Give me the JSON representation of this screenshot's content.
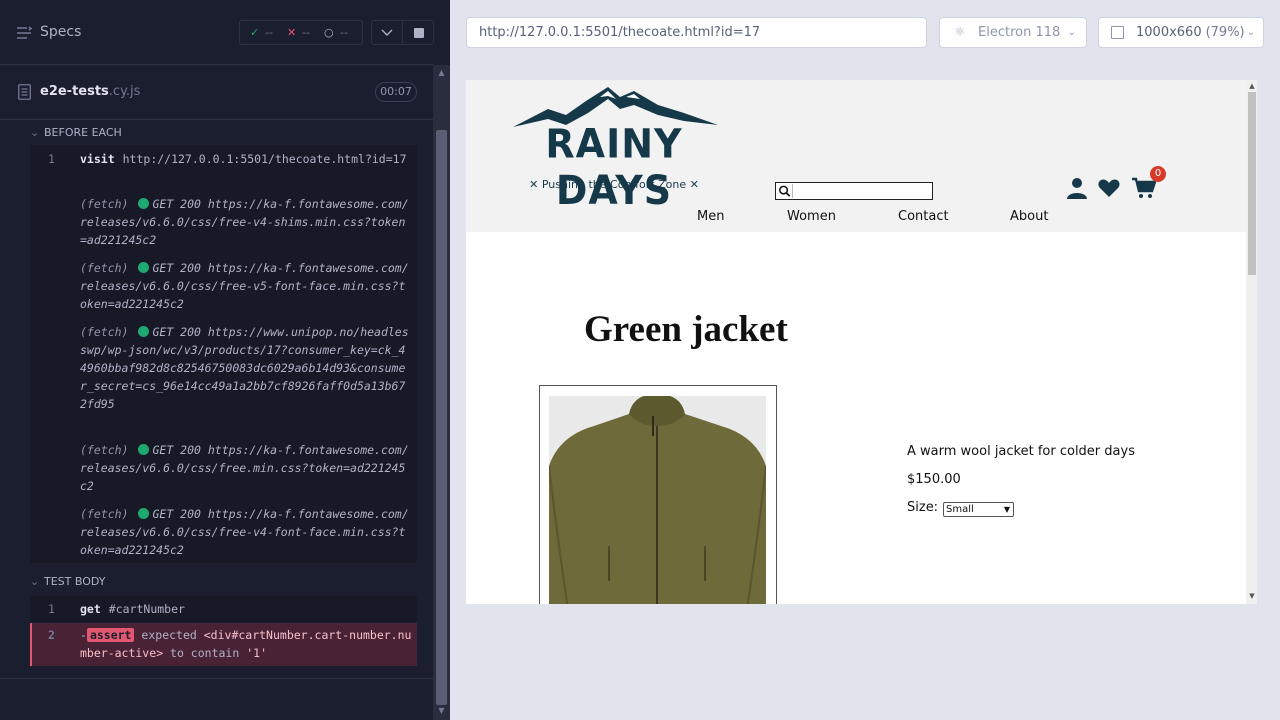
{
  "reporter": {
    "specs_label": "Specs",
    "stats": {
      "passed": "--",
      "failed": "--",
      "pending": "--"
    },
    "file": {
      "name": "e2e-tests",
      "ext": ".cy.js",
      "duration": "00:07"
    },
    "before_each": {
      "title": "BEFORE EACH",
      "commands": [
        {
          "num": "1",
          "name": "visit",
          "message": "http://127.0.0.1:5501/thecoate.html?id=17"
        },
        {
          "label": "(fetch)",
          "method": "GET 200",
          "url": "https://ka-f.fontawesome.com/releases/v6.6.0/css/free-v4-shims.min.css?token=ad221245c2"
        },
        {
          "label": "(fetch)",
          "method": "GET 200",
          "url": "https://ka-f.fontawesome.com/releases/v6.6.0/css/free-v5-font-face.min.css?token=ad221245c2"
        },
        {
          "label": "(fetch)",
          "method": "GET 200",
          "url": "https://www.unipop.no/headlesswp/wp-json/wc/v3/products/17?consumer_key=ck_44960bbaf982d8c82546750083dc6029a6b14d93&consumer_secret=cs_96e14cc49a1a2bb7cf8926faff0d5a13b672fd95"
        },
        {
          "label": "(fetch)",
          "method": "GET 200",
          "url": "https://ka-f.fontawesome.com/releases/v6.6.0/css/free.min.css?token=ad221245c2"
        },
        {
          "label": "(fetch)",
          "method": "GET 200",
          "url": "https://ka-f.fontawesome.com/releases/v6.6.0/css/free-v4-font-face.min.css?token=ad221245c2"
        }
      ]
    },
    "test_body": {
      "title": "TEST BODY",
      "get": {
        "num": "1",
        "name": "get",
        "message": "#cartNumber"
      },
      "assert": {
        "num": "2",
        "prefix": "-",
        "name": "assert",
        "expected": "expected",
        "subject": "<div#cartNumber.cart-number.number-active>",
        "to_contain": "to contain",
        "value": "'1'"
      }
    }
  },
  "browser": {
    "url": "http://127.0.0.1:5501/thecoate.html?id=17",
    "browser_name": "Electron 118",
    "viewport": "1000x660",
    "zoom": "(79%)"
  },
  "site": {
    "logo_text": "RAINY DAYS",
    "logo_tagline": "✕ Pushing the Comfort Zone ✕",
    "cart_count": "0",
    "nav": {
      "men": "Men",
      "women": "Women",
      "contact": "Contact",
      "about": "About"
    },
    "product": {
      "title": "Green jacket",
      "description": "A warm wool jacket for colder days",
      "price": "$150.00",
      "size_label": "Size:",
      "size_selected": "Small"
    }
  },
  "colors": {
    "reporter_bg": "#1b1e2e",
    "pass_green": "#1fa971",
    "fail_red": "#e45770",
    "logo_teal": "#16394a",
    "cart_badge": "#d63b2a"
  }
}
